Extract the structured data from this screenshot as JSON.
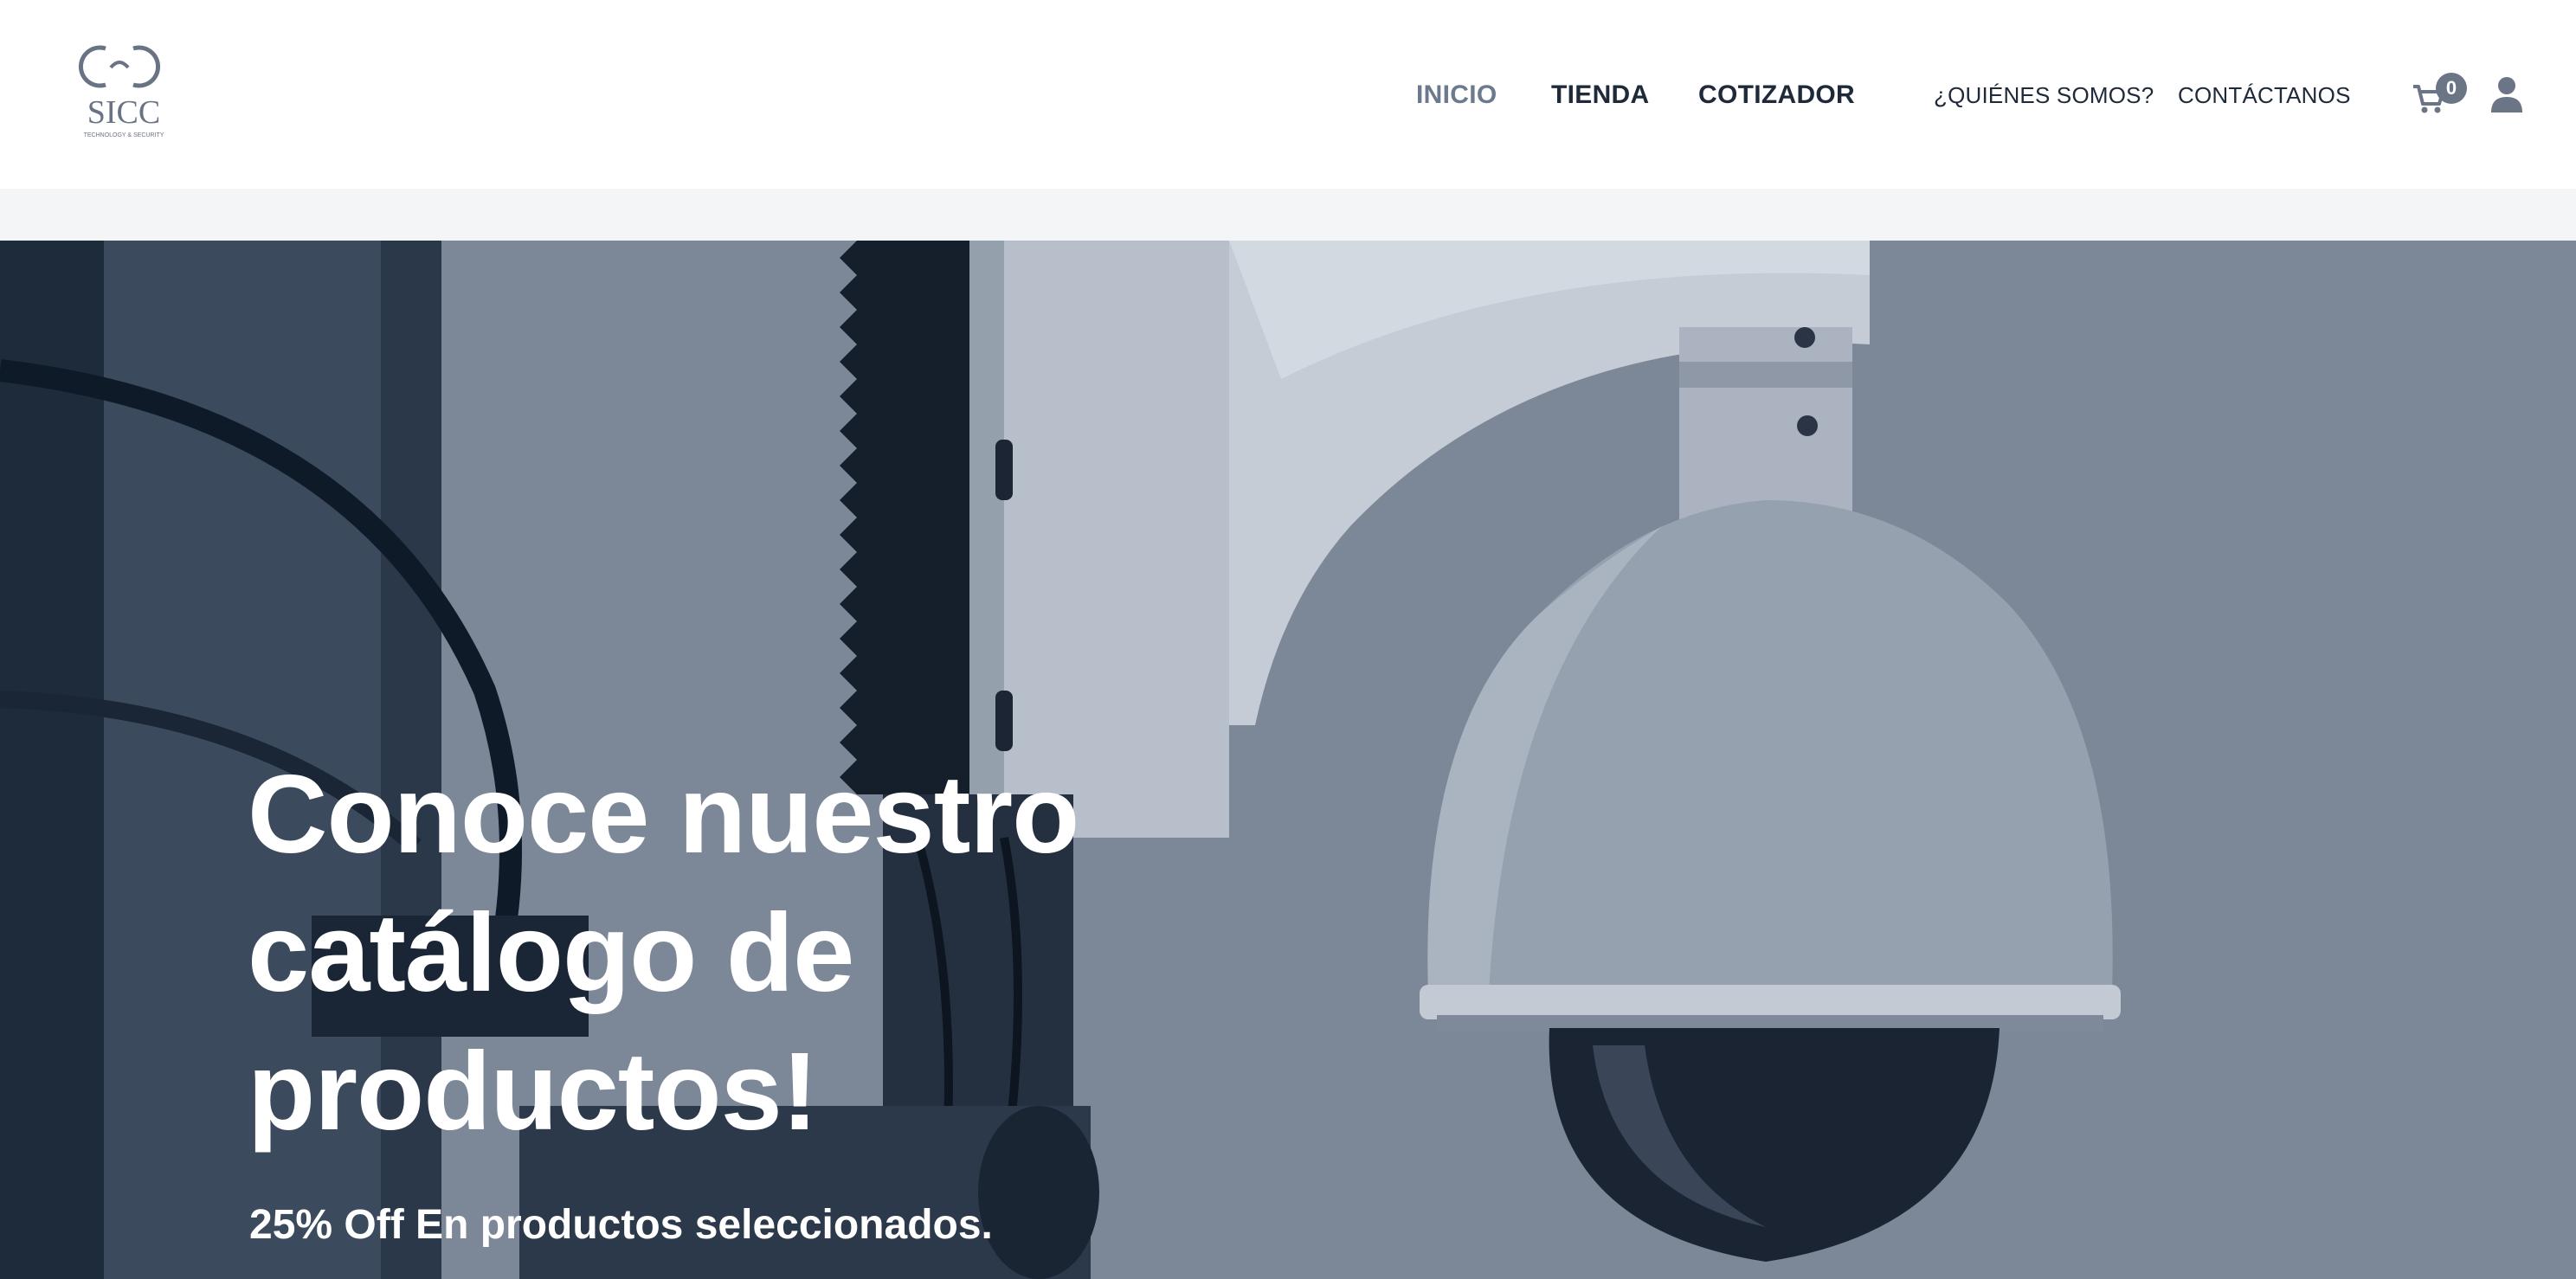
{
  "header": {
    "logo": {
      "text": "SICC",
      "tagline": "TECHNOLOGY & SECURITY"
    },
    "nav_main": [
      {
        "label": "INICIO",
        "active": true
      },
      {
        "label": "TIENDA",
        "active": false
      },
      {
        "label": "COTIZADOR",
        "active": false
      }
    ],
    "nav_secondary": [
      {
        "label": "¿QUIÉNES SOMOS?"
      },
      {
        "label": "CONTÁCTANOS"
      }
    ],
    "cart": {
      "icon": "cart-icon",
      "count": "0"
    },
    "user": {
      "icon": "user-icon"
    }
  },
  "hero": {
    "title": "Conoce nuestro\ncatálogo de\nproductos!",
    "subtitle": "25% Off En productos seleccionados.",
    "image": "security-dome-camera-photo",
    "overlay_color": "#7c8898"
  },
  "colors": {
    "nav_text": "#1e2a3a",
    "nav_active": "#6b7a8d",
    "band": "#f4f5f7",
    "hero_text": "#ffffff"
  }
}
